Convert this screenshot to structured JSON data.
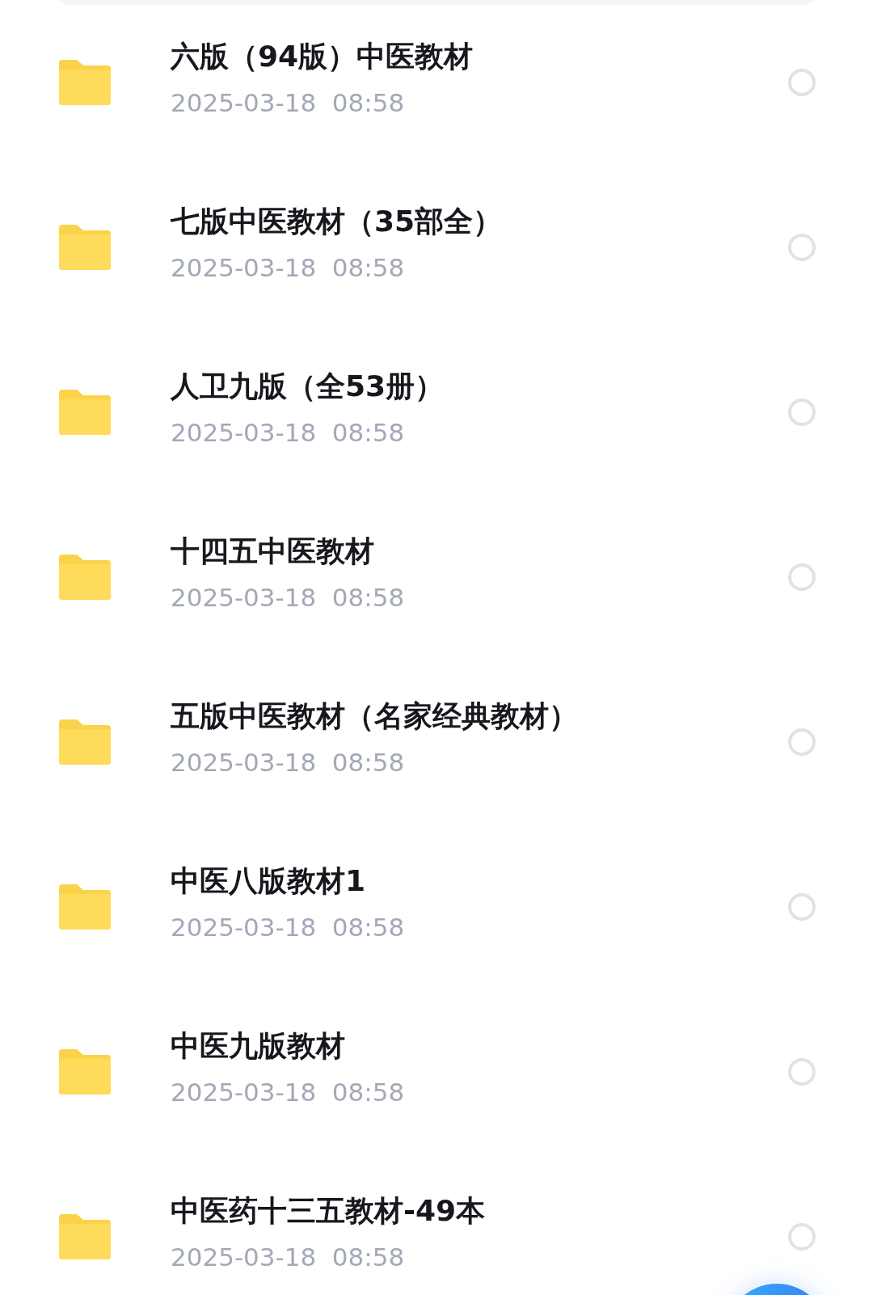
{
  "files": [
    {
      "kind": "folder",
      "name": "六版（94版）中医教材",
      "date": "2025-03-18  08:58",
      "selected": false
    },
    {
      "kind": "folder",
      "name": "七版中医教材（35部全）",
      "date": "2025-03-18  08:58",
      "selected": false
    },
    {
      "kind": "folder",
      "name": "人卫九版（全53册）",
      "date": "2025-03-18  08:58",
      "selected": false
    },
    {
      "kind": "folder",
      "name": "十四五中医教材",
      "date": "2025-03-18  08:58",
      "selected": false
    },
    {
      "kind": "folder",
      "name": "五版中医教材（名家经典教材）",
      "date": "2025-03-18  08:58",
      "selected": false
    },
    {
      "kind": "folder",
      "name": "中医八版教材1",
      "date": "2025-03-18  08:58",
      "selected": false
    },
    {
      "kind": "folder",
      "name": "中医九版教材",
      "date": "2025-03-18  08:58",
      "selected": false
    },
    {
      "kind": "folder",
      "name": "中医药十三五教材-49本",
      "date": "2025-03-18  08:58",
      "selected": false
    }
  ]
}
